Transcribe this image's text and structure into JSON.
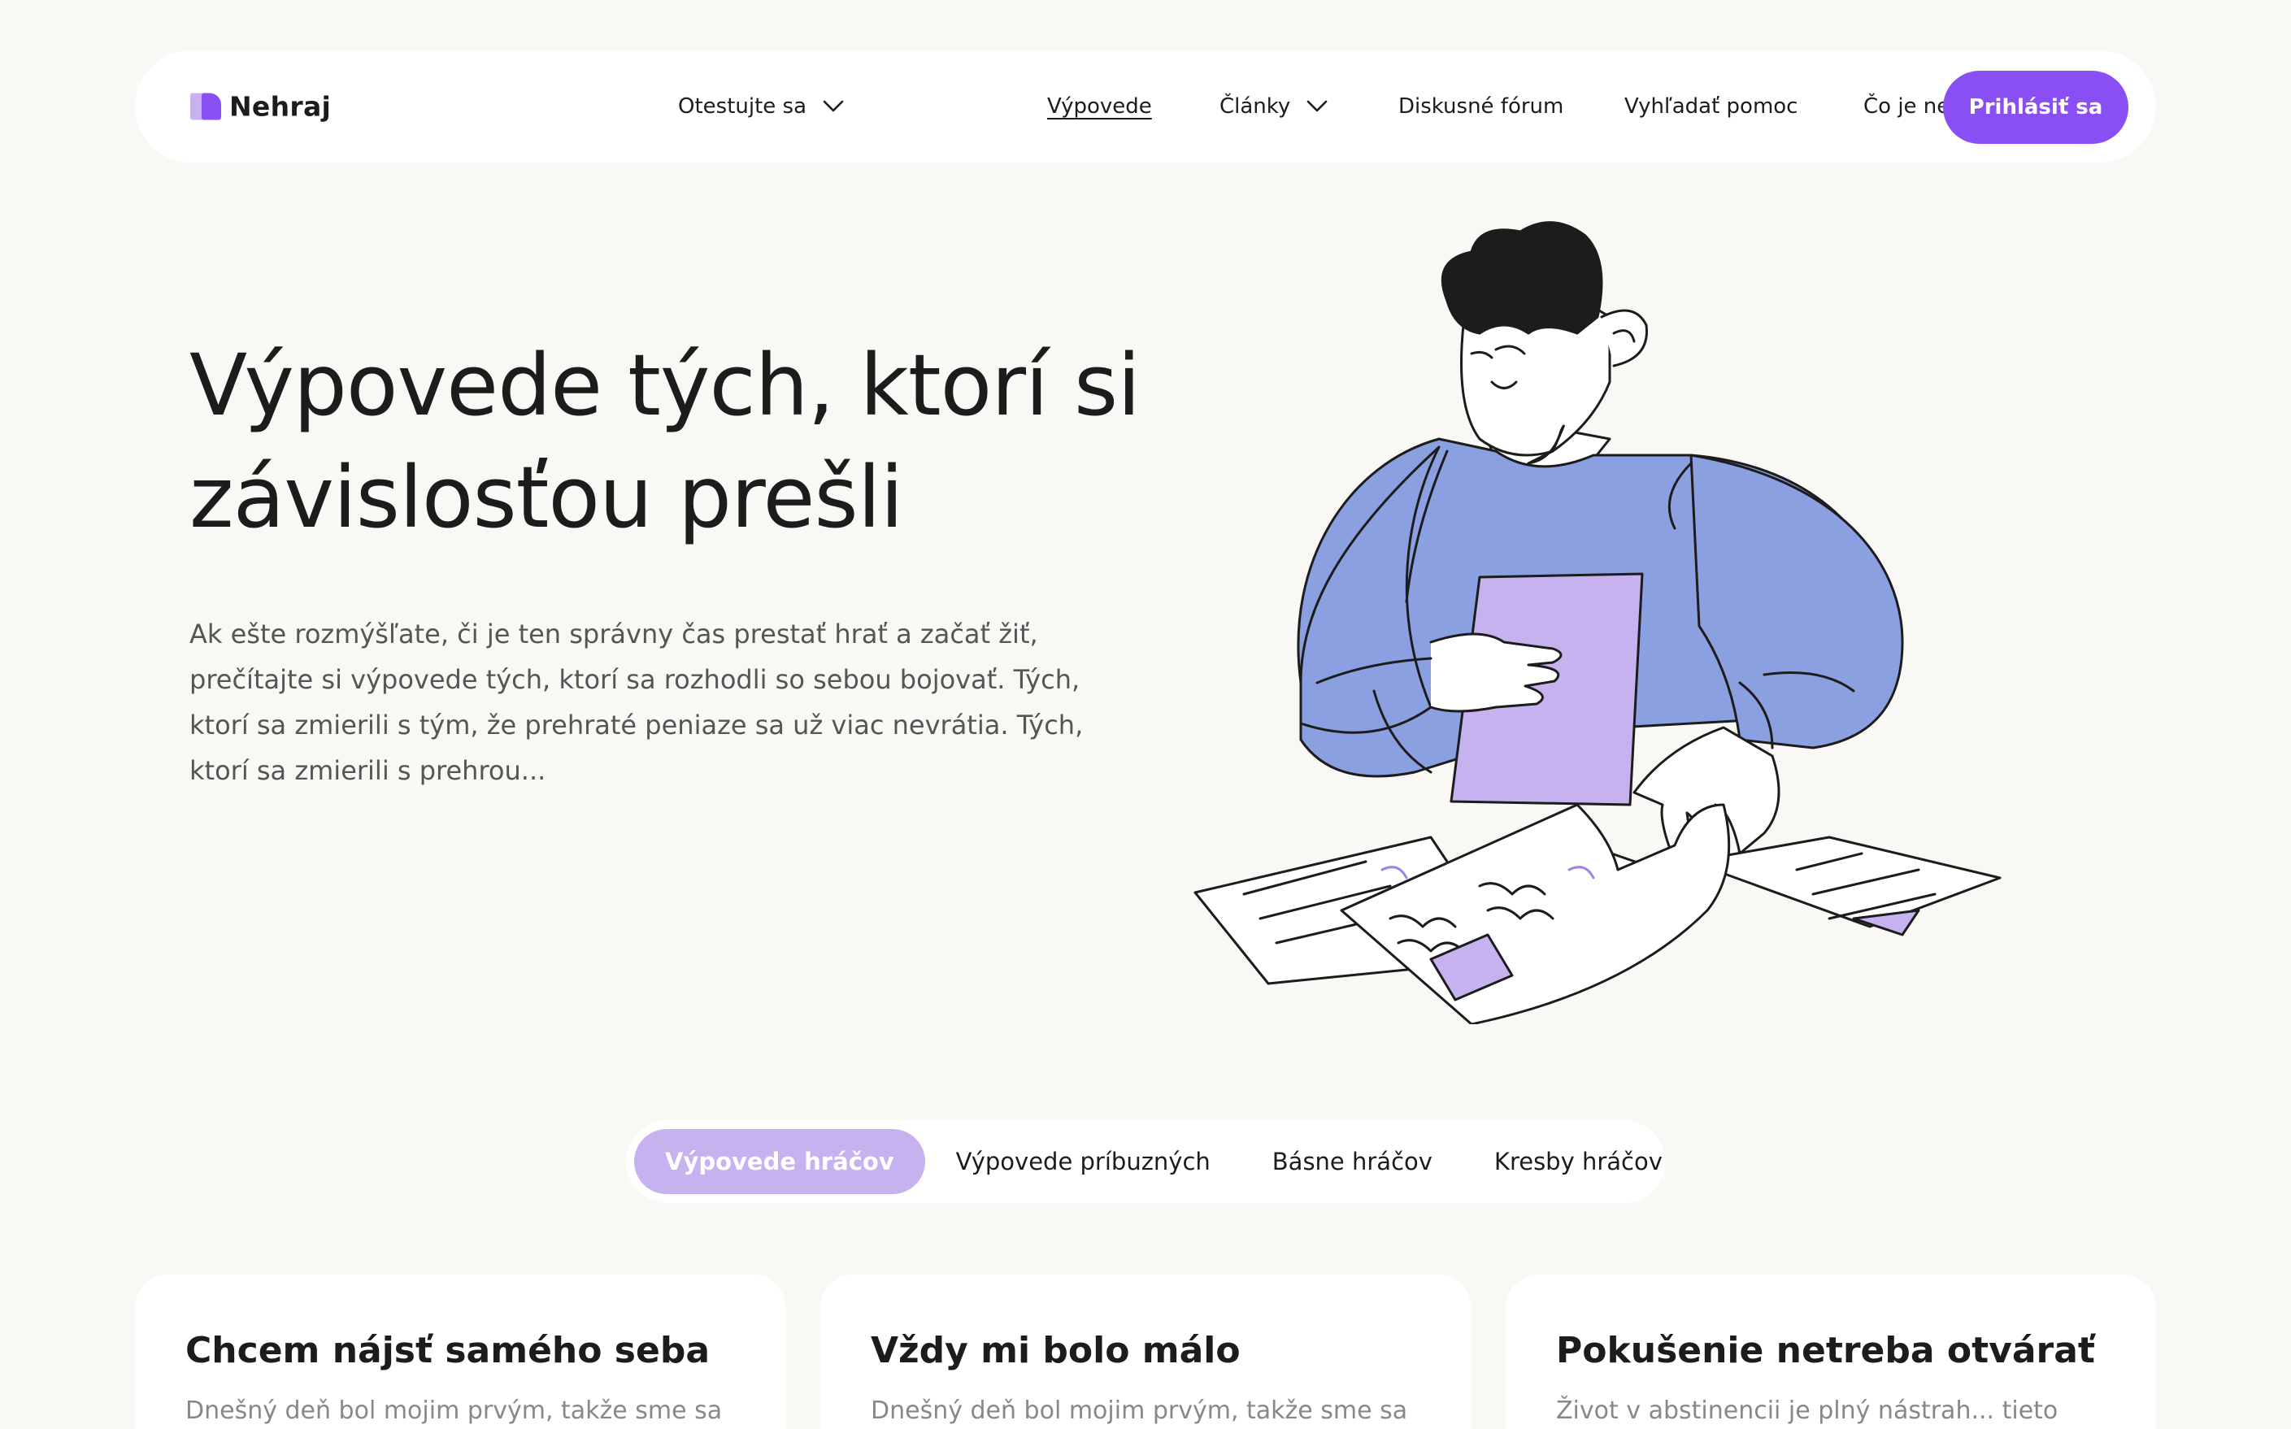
{
  "brand": {
    "name": "Nehraj",
    "accent": "#8a4ff3",
    "accent_light": "#c6b2ef"
  },
  "nav": {
    "items": [
      {
        "label": "Otestujte sa",
        "dropdown": true,
        "active": false
      },
      {
        "label": "Výpovede",
        "dropdown": false,
        "active": true
      },
      {
        "label": "Články",
        "dropdown": true,
        "active": false
      },
      {
        "label": "Diskusné fórum",
        "dropdown": false,
        "active": false
      },
      {
        "label": "Vyhľadať pomoc",
        "dropdown": false,
        "active": false
      },
      {
        "label": "Čo je nehraj.sk",
        "dropdown": false,
        "active": false
      }
    ],
    "login_label": "Prihlásiť sa"
  },
  "hero": {
    "title": "Výpovede tých, ktorí si závislosťou prešli",
    "description": "Ak ešte rozmýšľate, či je ten správny čas prestať hrať a začať žiť, prečítajte si výpovede tých, ktorí sa rozhodli so sebou bojovať. Tých, ktorí sa zmierili s tým, že prehraté peniaze sa už viac nevrátia. Tých, ktorí sa zmierili s prehrou..."
  },
  "tabs": [
    {
      "label": "Výpovede hráčov",
      "active": true
    },
    {
      "label": "Výpovede príbuzných",
      "active": false
    },
    {
      "label": "Básne hráčov",
      "active": false
    },
    {
      "label": "Kresby hráčov",
      "active": false
    }
  ],
  "cards": [
    {
      "title": "Chcem nájsť samého seba",
      "excerpt": "Dnešný deň bol mojim prvým, takže sme sa"
    },
    {
      "title": "Vždy mi bolo málo",
      "excerpt": "Dnešný deň bol mojim prvým, takže sme sa"
    },
    {
      "title": "Pokušenie netreba otvárať",
      "excerpt": "Život v abstinencii je plný nástrah... tieto"
    }
  ]
}
